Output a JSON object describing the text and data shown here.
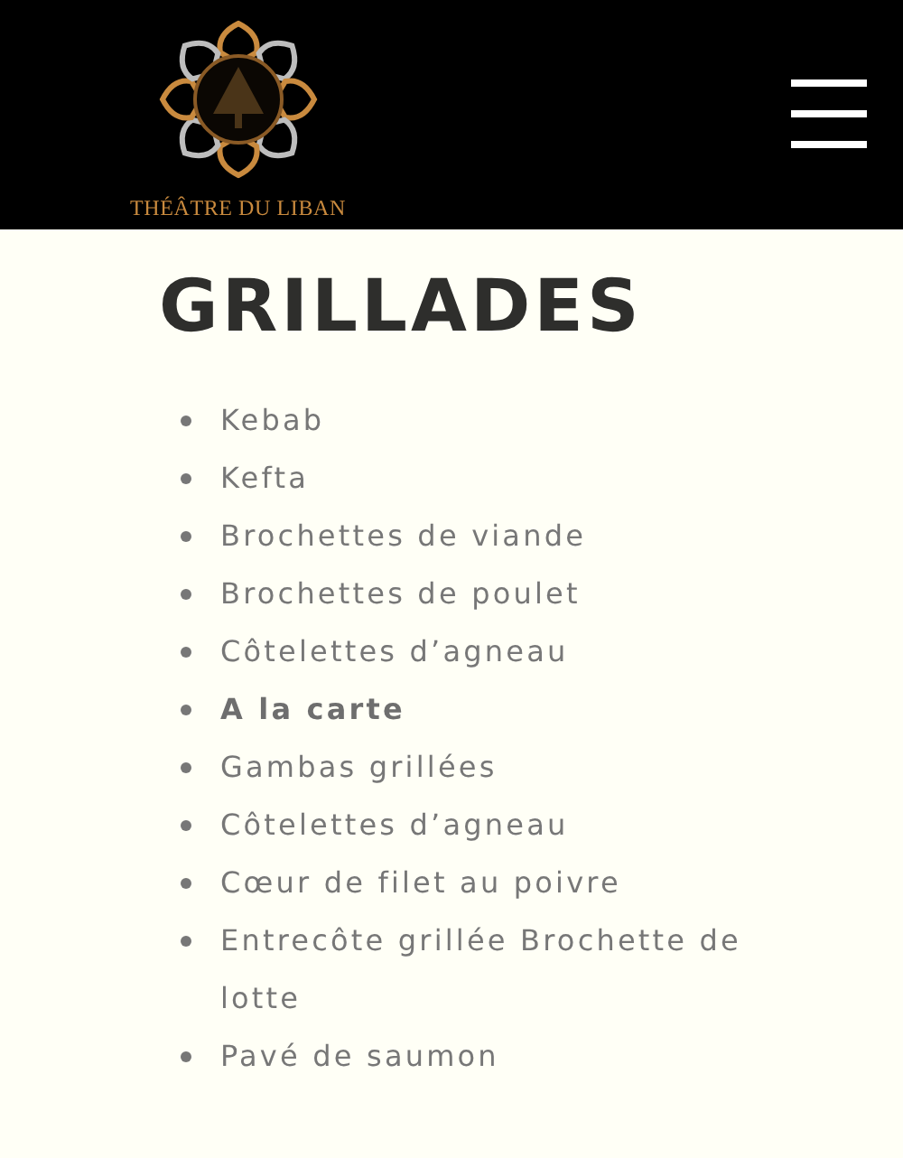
{
  "header": {
    "logo_text": "THÉÂTRE DU LIBAN"
  },
  "title": "GRILLADES",
  "items": [
    {
      "label": "Kebab",
      "bold": false
    },
    {
      "label": "Kefta",
      "bold": false
    },
    {
      "label": "Brochettes de viande",
      "bold": false
    },
    {
      "label": "Brochettes de poulet",
      "bold": false
    },
    {
      "label": "Côtelettes d’agneau",
      "bold": false
    },
    {
      "label": "A la carte",
      "bold": true
    },
    {
      "label": "Gambas grillées",
      "bold": false
    },
    {
      "label": "Côtelettes d’agneau",
      "bold": false
    },
    {
      "label": "Cœur de filet au poivre",
      "bold": false
    },
    {
      "label": "Entrecôte grillée Brochette de lotte",
      "bold": false
    },
    {
      "label": "Pavé de saumon",
      "bold": false
    }
  ]
}
